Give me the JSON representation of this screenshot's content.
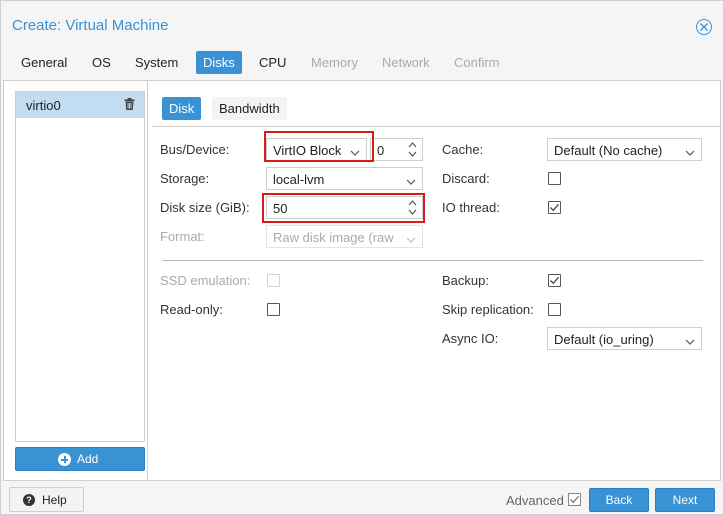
{
  "window": {
    "title": "Create: Virtual Machine"
  },
  "tabs": [
    {
      "label": "General",
      "state": "normal"
    },
    {
      "label": "OS",
      "state": "normal"
    },
    {
      "label": "System",
      "state": "normal"
    },
    {
      "label": "Disks",
      "state": "active"
    },
    {
      "label": "CPU",
      "state": "normal"
    },
    {
      "label": "Memory",
      "state": "disabled"
    },
    {
      "label": "Network",
      "state": "disabled"
    },
    {
      "label": "Confirm",
      "state": "disabled"
    }
  ],
  "device_list": {
    "items": [
      {
        "label": "virtio0",
        "selected": true
      }
    ],
    "add_label": "Add"
  },
  "subtabs": [
    {
      "label": "Disk",
      "active": true
    },
    {
      "label": "Bandwidth",
      "active": false
    }
  ],
  "form": {
    "bus_device": {
      "label": "Bus/Device:",
      "bus_value": "VirtIO Block",
      "device_index": "0"
    },
    "storage": {
      "label": "Storage:",
      "value": "local-lvm"
    },
    "disk_size": {
      "label": "Disk size (GiB):",
      "value": "50"
    },
    "format": {
      "label": "Format:",
      "value": "Raw disk image (raw",
      "disabled": true
    },
    "cache": {
      "label": "Cache:",
      "value": "Default (No cache)"
    },
    "discard": {
      "label": "Discard:",
      "checked": false
    },
    "io_thread": {
      "label": "IO thread:",
      "checked": true
    },
    "ssd_emulation": {
      "label": "SSD emulation:",
      "checked": false,
      "disabled": true
    },
    "read_only": {
      "label": "Read-only:",
      "checked": false
    },
    "backup": {
      "label": "Backup:",
      "checked": true
    },
    "skip_replication": {
      "label": "Skip replication:",
      "checked": false
    },
    "async_io": {
      "label": "Async IO:",
      "value": "Default (io_uring)"
    }
  },
  "footer": {
    "help_label": "Help",
    "advanced_label": "Advanced",
    "advanced_checked": true,
    "back_label": "Back",
    "next_label": "Next"
  },
  "colors": {
    "accent": "#3892d4",
    "selection": "#c2ddf2",
    "highlight_box": "#d71a1a"
  }
}
